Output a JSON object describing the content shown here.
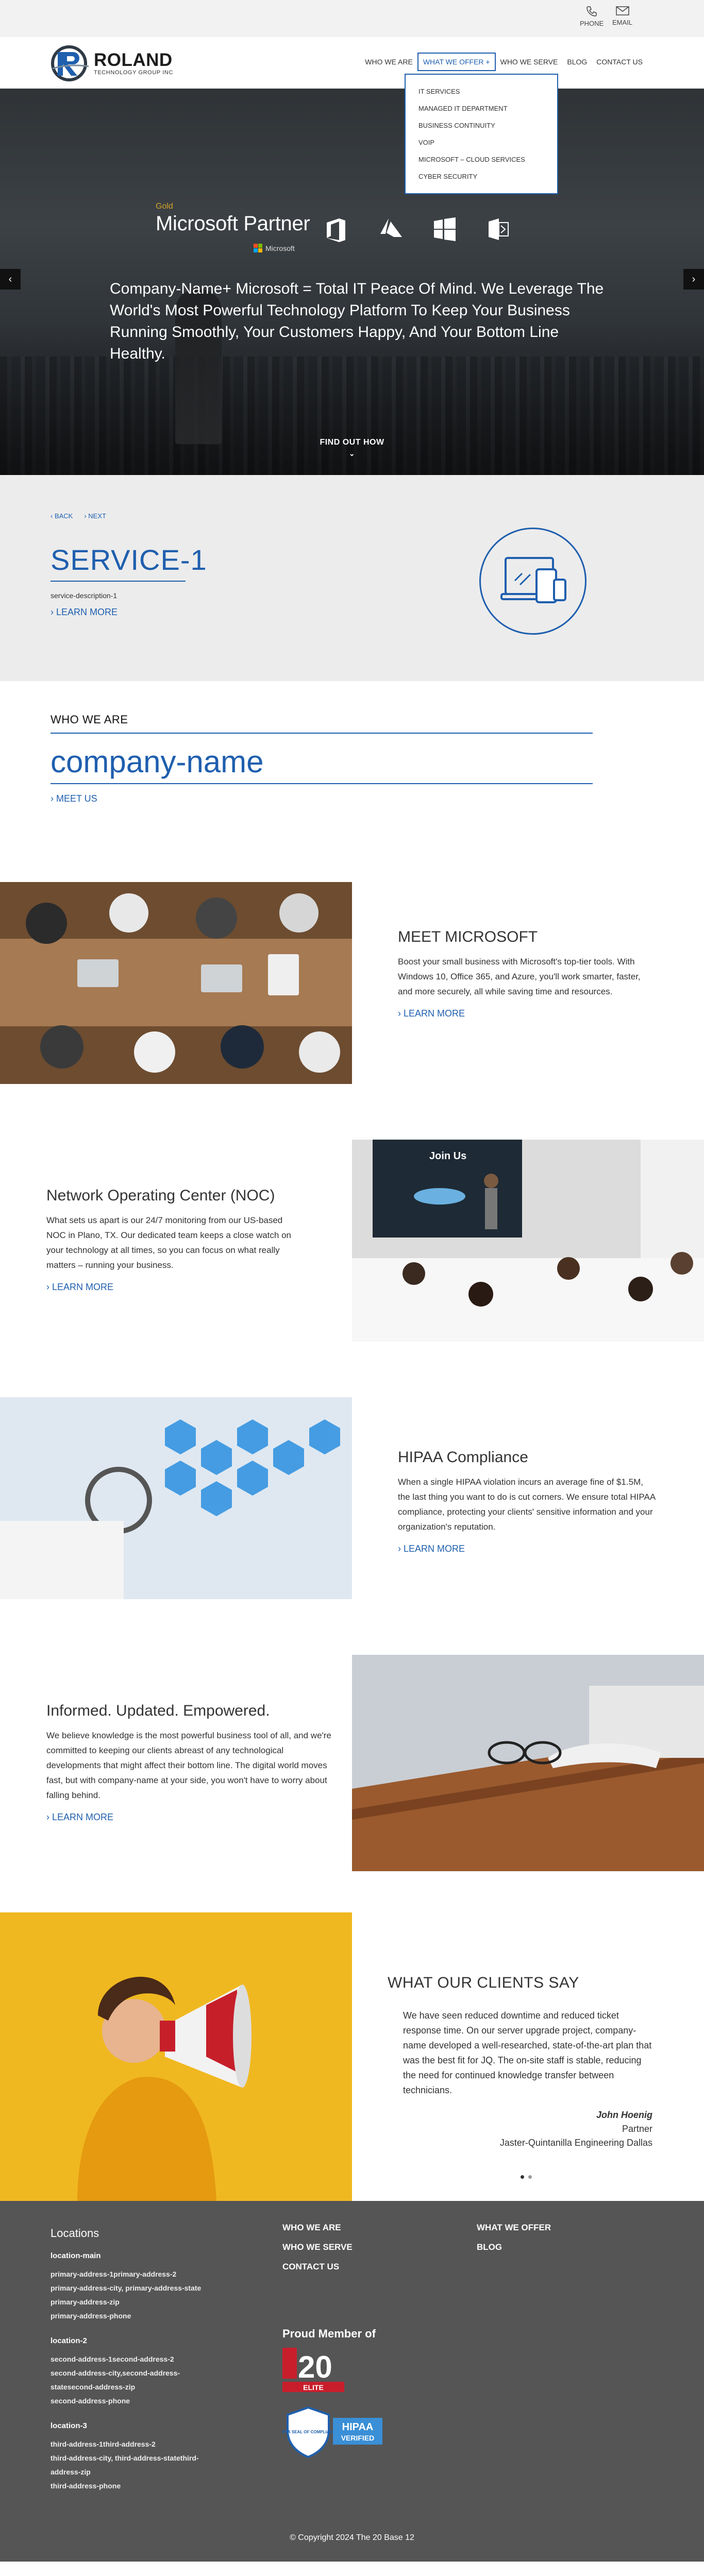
{
  "topbar": {
    "phone_label": "PHONE",
    "email_label": "EMAIL"
  },
  "logo": {
    "name": "ROLAND",
    "tagline": "TECHNOLOGY GROUP INC"
  },
  "nav": {
    "items": [
      "WHO WE ARE",
      "WHAT WE OFFER",
      "WHO WE SERVE",
      "BLOG",
      "CONTACT US"
    ],
    "active_caret": "+"
  },
  "dropdown": {
    "items": [
      "IT SERVICES",
      "MANAGED IT DEPARTMENT",
      "BUSINESS CONTINUITY",
      "VOIP",
      "MICROSOFT – CLOUD SERVICES",
      "CYBER SECURITY"
    ]
  },
  "hero": {
    "partner_tier": "Gold",
    "partner_title": "Microsoft Partner",
    "partner_brand": "Microsoft",
    "headline": "Company-Name+ Microsoft = Total IT Peace Of Mind. We Leverage The World's Most Powerful Technology Platform To Keep Your Business Running Smoothly, Your Customers Happy, And Your Bottom Line Healthy.",
    "cta": "FIND OUT HOW",
    "prev": "‹",
    "next": "›"
  },
  "services": {
    "back": "‹ BACK",
    "next": "› NEXT",
    "title": "SERVICE-1",
    "description": "service-description-1",
    "more": "› LEARN MORE"
  },
  "who": {
    "label": "WHO WE ARE",
    "company": "company-name",
    "more": "› MEET US"
  },
  "features": [
    {
      "title": "MEET MICROSOFT",
      "body": "Boost your small business with Microsoft's top-tier tools. With Windows 10, Office 365, and Azure, you'll work smarter, faster, and more securely, all while saving time and resources.",
      "more": "› LEARN MORE"
    },
    {
      "title": "Network Operating Center (NOC)",
      "body": "What sets us apart is our 24/7 monitoring from our US-based NOC in Plano, TX. Our dedicated team keeps a close watch on your technology at all times, so you can focus on what really matters – running your business.",
      "more": "› LEARN MORE",
      "img_text": "Join Us"
    },
    {
      "title": "HIPAA Compliance",
      "body": "When a single HIPAA violation incurs an average fine of $1.5M, the last thing you want to do is cut corners. We ensure total HIPAA compliance, protecting your clients' sensitive information and your organization's reputation.",
      "more": "› LEARN MORE"
    },
    {
      "title": "Informed. Updated. Empowered.",
      "body": "We believe knowledge is the most powerful business tool of all, and we're committed to keeping our clients abreast of any technological developments that might affect their bottom line. The digital world moves fast, but with company-name at your side, you won't have to worry about falling behind.",
      "more": "› LEARN MORE"
    }
  ],
  "testimonial": {
    "heading": "WHAT OUR CLIENTS SAY",
    "quote": "We have seen reduced downtime and reduced ticket response time. On our server upgrade project, company-name developed a well-researched, state-of-the-art plan that was the best fit for JQ. The on-site staff is stable, reducing the need for continued knowledge transfer between technicians.",
    "author": "John Hoenig",
    "role": "Partner",
    "company": "Jaster-Quintanilla Engineering Dallas"
  },
  "footer": {
    "locations_title": "Locations",
    "locations": [
      {
        "name": "location-main",
        "lines": [
          "primary-address-1primary-address-2",
          "primary-address-city, primary-address-state",
          "primary-address-zip",
          "primary-address-phone"
        ]
      },
      {
        "name": "location-2",
        "lines": [
          "second-address-1second-address-2",
          "second-address-city,second-address-",
          "statesecond-address-zip",
          "second-address-phone"
        ]
      },
      {
        "name": "location-3",
        "lines": [
          "third-address-1third-address-2",
          "third-address-city, third-address-statethird-",
          "address-zip",
          "third-address-phone"
        ]
      }
    ],
    "col1": [
      "WHO WE ARE",
      "WHO WE SERVE",
      "CONTACT US"
    ],
    "col2": [
      "WHAT WE OFFER",
      "BLOG"
    ],
    "proud": "Proud Member of",
    "badge_20": "20",
    "badge_elite": "ELITE",
    "badge_hipaa": "HIPAA",
    "badge_verified": "VERIFIED",
    "badge_seal": "HIPAA SEAL OF COMPLIANCE",
    "copyright": "© Copyright 2024 The 20 Base 12"
  },
  "colors": {
    "brand_blue": "#1f5fae",
    "footer_bg": "#555555",
    "services_bg": "#ececec"
  }
}
